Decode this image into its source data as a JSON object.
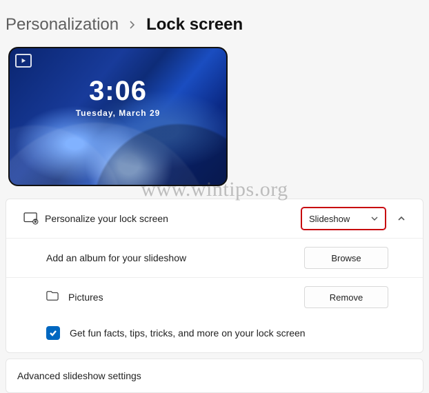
{
  "breadcrumb": {
    "parent": "Personalization",
    "current": "Lock screen"
  },
  "preview": {
    "time": "3:06",
    "date": "Tuesday, March 29"
  },
  "watermark": "www.wintips.org",
  "personalize": {
    "title": "Personalize your lock screen",
    "dropdown_value": "Slideshow",
    "album_label": "Add an album for your slideshow",
    "browse": "Browse",
    "pictures": "Pictures",
    "remove": "Remove",
    "funfacts": "Get fun facts, tips, tricks, and more on your lock screen"
  },
  "advanced": {
    "title": "Advanced slideshow settings"
  }
}
